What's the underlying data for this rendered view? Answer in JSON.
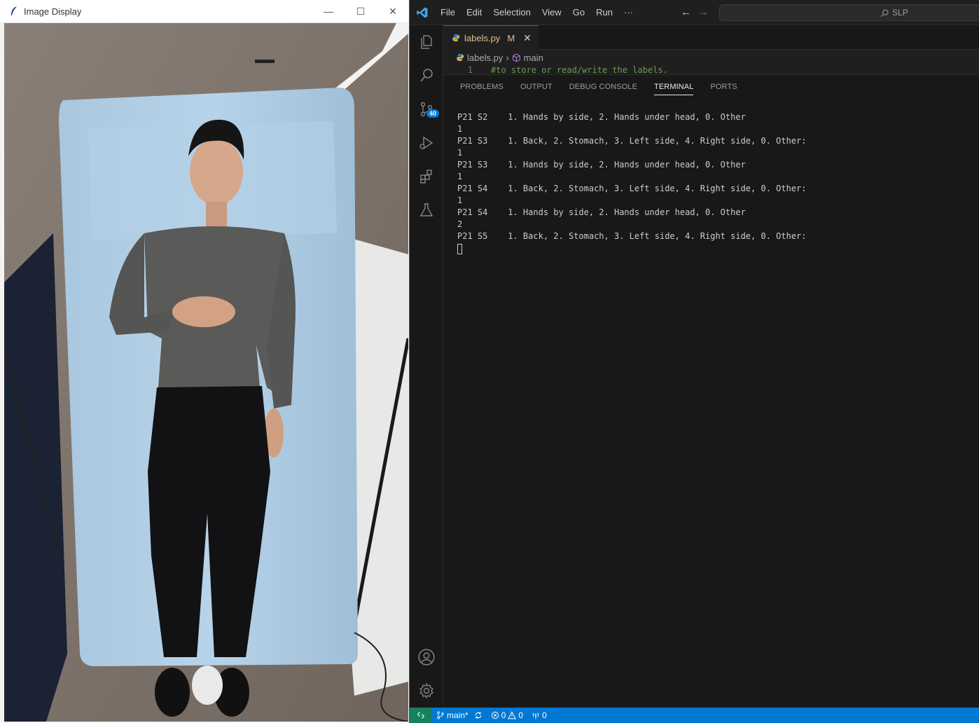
{
  "image_window": {
    "title": "Image Display",
    "controls": {
      "minimize": "—",
      "maximize": "☐",
      "close": "✕"
    }
  },
  "vscode": {
    "menu": [
      "File",
      "Edit",
      "Selection",
      "View",
      "Go",
      "Run",
      "···"
    ],
    "search_label": "SLP",
    "activity_badge": "40",
    "tab": {
      "filename": "labels.py",
      "status": "M"
    },
    "breadcrumb": {
      "file": "labels.py",
      "symbol": "main"
    },
    "code_peek": {
      "line_number": "1",
      "text": "#to store or read/write the labels."
    },
    "panel_tabs": [
      "PROBLEMS",
      "OUTPUT",
      "DEBUG CONSOLE",
      "TERMINAL",
      "PORTS"
    ],
    "active_panel_tab": "TERMINAL",
    "terminal_lines": [
      "P21 S2    1. Hands by side, 2. Hands under head, 0. Other",
      "1",
      "P21 S3    1. Back, 2. Stomach, 3. Left side, 4. Right side, 0. Other:",
      "1",
      "P21 S3    1. Hands by side, 2. Hands under head, 0. Other",
      "1",
      "P21 S4    1. Back, 2. Stomach, 3. Left side, 4. Right side, 0. Other:",
      "1",
      "P21 S4    1. Hands by side, 2. Hands under head, 0. Other",
      "2",
      "P21 S5    1. Back, 2. Stomach, 3. Left side, 4. Right side, 0. Other:"
    ],
    "statusbar": {
      "branch": "main*",
      "errors": "0",
      "warnings": "0",
      "ports": "0"
    }
  },
  "colors": {
    "accent": "#0078d4",
    "remote": "#16825d",
    "modified": "#e2c08d"
  }
}
